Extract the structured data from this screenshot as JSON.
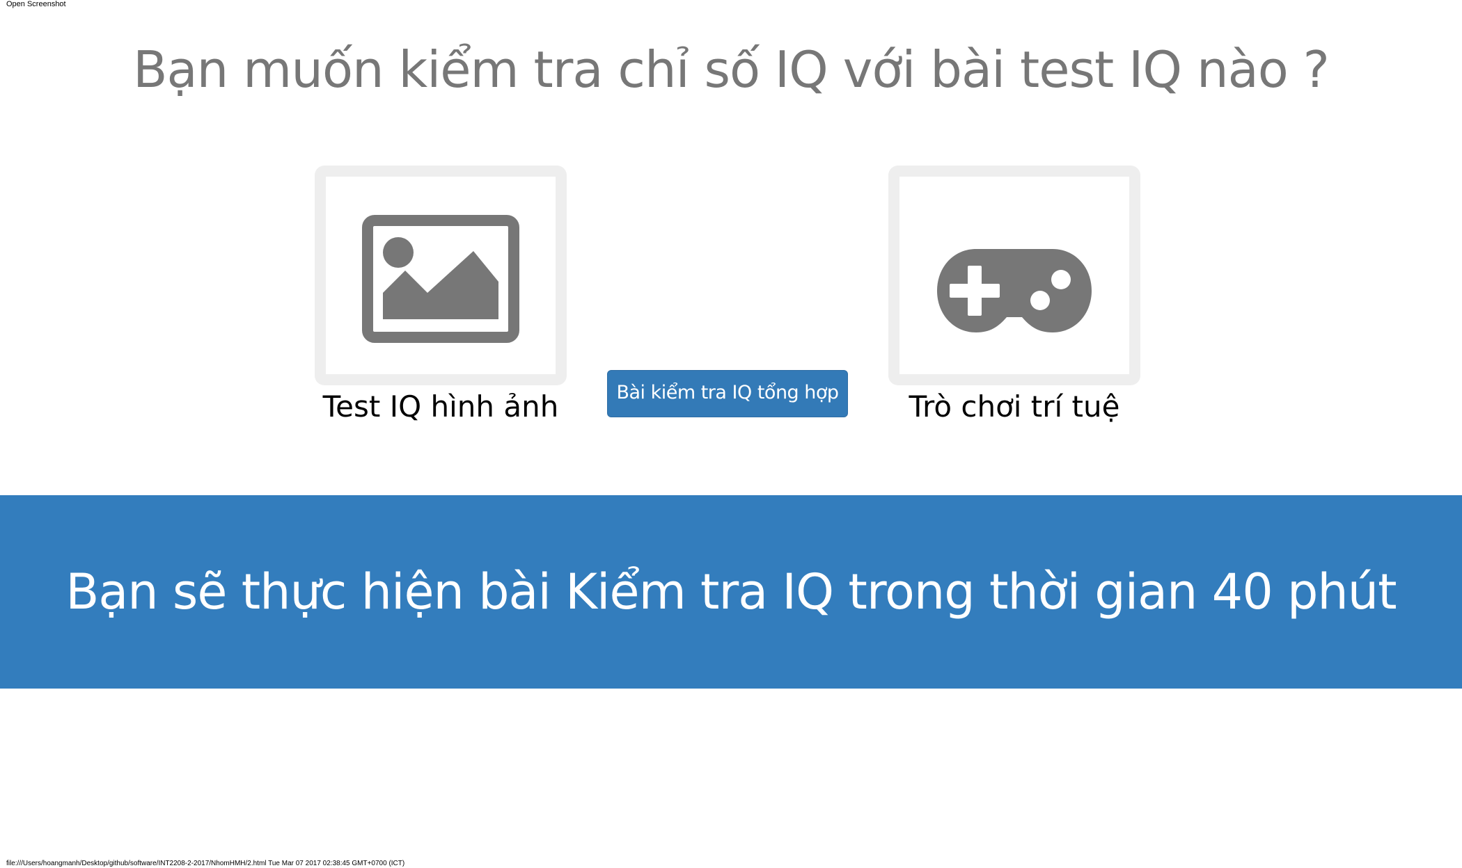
{
  "print": {
    "header": "Open Screenshot",
    "footer": "file:///Users/hoangmanh/Desktop/github/software/INT2208-2-2017/NhomHMH/2.html Tue Mar 07 2017 02:38:45 GMT+0700 (ICT)"
  },
  "main": {
    "title": "Bạn muốn kiểm tra chỉ số IQ với bài test IQ nào ?",
    "options": [
      {
        "label": "Test IQ hình ảnh",
        "icon": "image-icon"
      },
      {
        "label": "Trò chơi trí tuệ",
        "icon": "gamepad-icon"
      }
    ],
    "center_button_label": "Bài kiểm tra IQ tổng hợp"
  },
  "banner": {
    "text": "Bạn sẽ thực hiện bài Kiểm tra IQ trong thời gian 40 phút"
  },
  "colors": {
    "primary": "#337ab7",
    "banner": "#337dbd",
    "icon": "#777777",
    "card_border": "#eeeeee",
    "title": "#777777"
  }
}
